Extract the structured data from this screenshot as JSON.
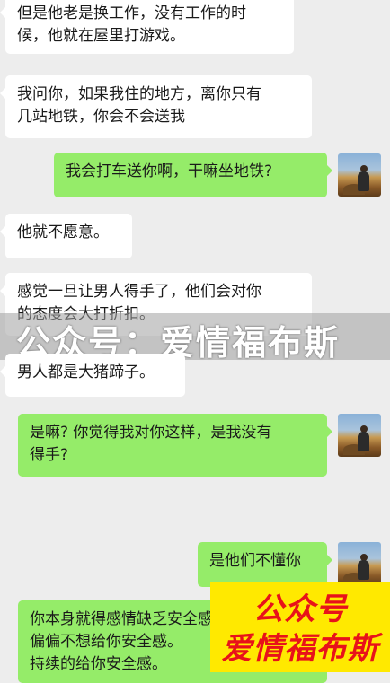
{
  "messages": [
    {
      "side": "left",
      "text": "但是他老是换工作，没有工作的时\n候，他就在屋里打游戏。"
    },
    {
      "side": "left",
      "text": "我问你，如果我住的地方，离你只有\n几站地铁，你会不会送我"
    },
    {
      "side": "right",
      "text": "我会打车送你啊，干嘛坐地铁?"
    },
    {
      "side": "left",
      "text": "他就不愿意。"
    },
    {
      "side": "left",
      "text": "感觉一旦让男人得手了，他们会对你\n的态度会大打折扣。"
    },
    {
      "side": "left",
      "text": "男人都是大猪蹄子。"
    },
    {
      "side": "right",
      "text": "是嘛? 你觉得我对你这样，是我没有\n得手?"
    },
    {
      "side": "right",
      "text": "是他们不懂你"
    },
    {
      "side": "right",
      "text": "你本身就得感情缺乏安全感\n偏偏不想给你安全感。\n持续的给你安全感。"
    }
  ],
  "watermark": {
    "banner": "公众号：爱情福布斯",
    "logo_line1": "公众号",
    "logo_line2": "爱情福布斯"
  },
  "colors": {
    "background": "#ededed",
    "bubble_left": "#ffffff",
    "bubble_right": "#95ec69",
    "logo_bg": "#ffe900",
    "logo_text": "#e8121a"
  },
  "icons": {
    "avatar": "user-avatar-photo"
  }
}
